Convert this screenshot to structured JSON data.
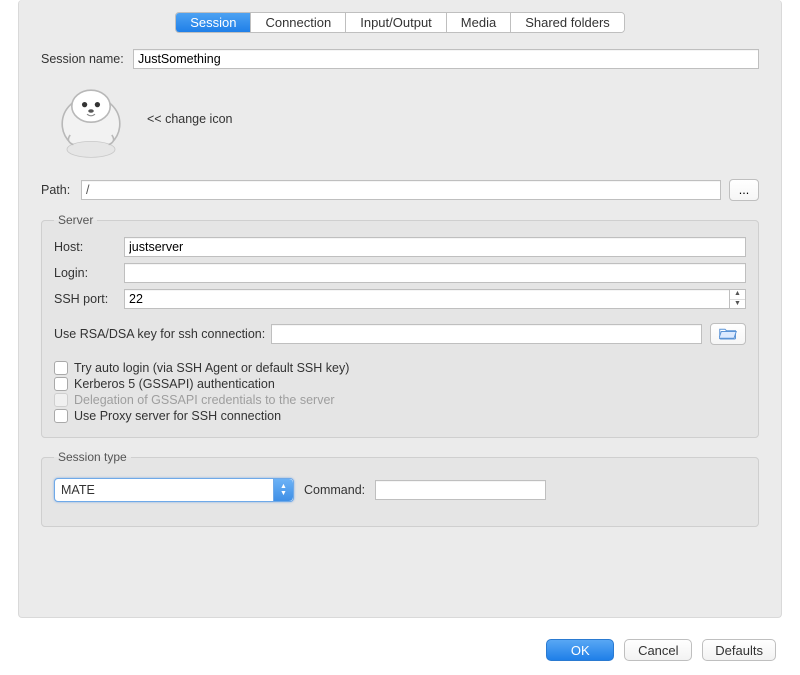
{
  "tabs": {
    "session": "Session",
    "connection": "Connection",
    "io": "Input/Output",
    "media": "Media",
    "shared": "Shared folders"
  },
  "labels": {
    "session_name": "Session name:",
    "change_icon": "<< change icon",
    "path": "Path:",
    "browse": "...",
    "server_group": "Server",
    "host": "Host:",
    "login": "Login:",
    "ssh_port": "SSH port:",
    "use_key": "Use RSA/DSA key for ssh connection:",
    "try_auto": "Try auto login (via SSH Agent or default SSH key)",
    "kerberos": "Kerberos 5 (GSSAPI) authentication",
    "delegation": "Delegation of GSSAPI credentials to the server",
    "use_proxy": "Use Proxy server for SSH connection",
    "session_type_group": "Session type",
    "command": "Command:"
  },
  "values": {
    "session_name": "JustSomething",
    "path": "/",
    "host": "justserver",
    "login": "",
    "ssh_port": "22",
    "key_path": "",
    "session_type": "MATE",
    "command": ""
  },
  "buttons": {
    "ok": "OK",
    "cancel": "Cancel",
    "defaults": "Defaults"
  }
}
